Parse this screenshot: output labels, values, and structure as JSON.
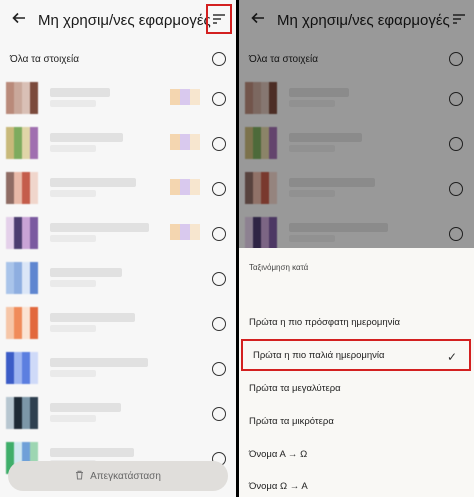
{
  "screen": {
    "title": "Μη χρησιμ/νες εφαρμογές",
    "back_icon": "arrow-left-icon",
    "sort_icon": "sort-icon",
    "all_items_label": "Όλα τα στοιχεία",
    "restore_label": "Απεγκατάσταση",
    "restore_icon": "trash-icon"
  },
  "sort_sheet": {
    "heading": "Ταξινόμηση κατά",
    "options": [
      {
        "label": "Πρώτα η πιο πρόσφατη ημερομηνία",
        "selected": false
      },
      {
        "label": "Πρώτα η πιο παλιά ημερομηνία",
        "selected": true
      },
      {
        "label": "Πρώτα τα μεγαλύτερα",
        "selected": false
      },
      {
        "label": "Πρώτα τα μικρότερα",
        "selected": false
      },
      {
        "label": "Όνομα Α → Ω",
        "selected": false
      },
      {
        "label": "Όνομα Ω → Α",
        "selected": false
      }
    ]
  },
  "colors": {
    "highlight": "#d32020",
    "background": "#f7f7f7",
    "scrim": "rgba(0,0,0,0.38)"
  }
}
